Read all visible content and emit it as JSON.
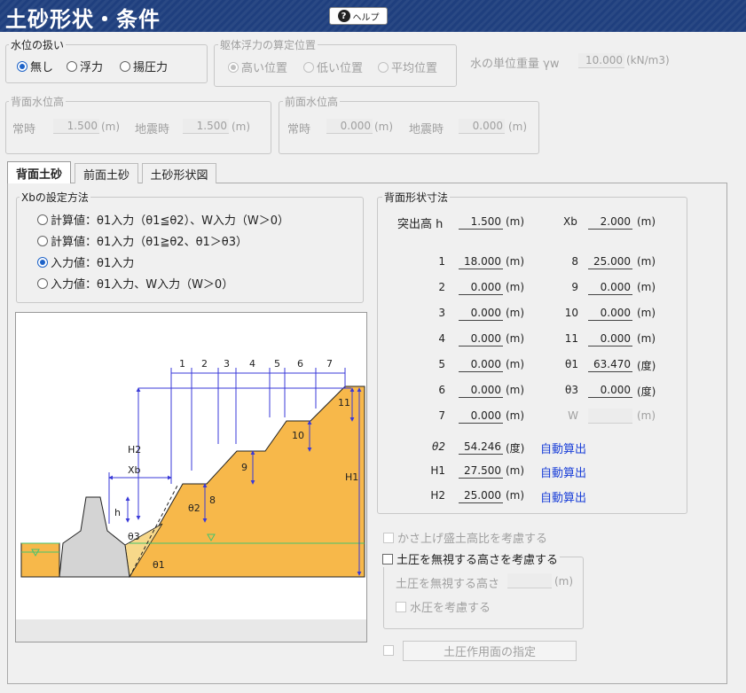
{
  "window": {
    "title": "土砂形状・条件",
    "help_label": "ヘルプ"
  },
  "water": {
    "label": "水位の扱い",
    "options": [
      "無し",
      "浮力",
      "揚圧力"
    ],
    "selected": "無し"
  },
  "buoyancy": {
    "label": "躯体浮力の算定位置",
    "options": [
      "高い位置",
      "低い位置",
      "平均位置"
    ],
    "selected": "高い位置"
  },
  "unit_weight": {
    "label": "水の単位重量 γw",
    "value": "10.000",
    "unit": "(kN/m3)"
  },
  "back_water": {
    "label": "背面水位高",
    "normal_label": "常時",
    "normal_value": "1.500",
    "normal_unit": "(m)",
    "quake_label": "地震時",
    "quake_value": "1.500",
    "quake_unit": "(m)"
  },
  "front_water": {
    "label": "前面水位高",
    "normal_label": "常時",
    "normal_value": "0.000",
    "normal_unit": "(m)",
    "quake_label": "地震時",
    "quake_value": "0.000",
    "quake_unit": "(m)"
  },
  "tabs": [
    {
      "label": "背面土砂",
      "active": true
    },
    {
      "label": "前面土砂",
      "active": false
    },
    {
      "label": "土砂形状図",
      "active": false
    }
  ],
  "xb_method": {
    "label": "Xbの設定方法",
    "options": [
      "計算値：θ1入力（θ1≦θ2）、W入力（W＞0）",
      "計算値：θ1入力（θ1≧θ2、θ1＞θ3）",
      "入力値：θ1入力",
      "入力値：θ1入力、W入力（W＞0）"
    ],
    "selected_index": 2
  },
  "shape": {
    "label": "背面形状寸法",
    "h_label": "突出高 h",
    "h_value": "1.500",
    "h_unit": "(m)",
    "xb_label": "Xb",
    "xb_value": "2.000",
    "xb_unit": "(m)",
    "left_rows": [
      {
        "label": "1",
        "value": "18.000",
        "unit": "(m)"
      },
      {
        "label": "2",
        "value": "0.000",
        "unit": "(m)"
      },
      {
        "label": "3",
        "value": "0.000",
        "unit": "(m)"
      },
      {
        "label": "4",
        "value": "0.000",
        "unit": "(m)"
      },
      {
        "label": "5",
        "value": "0.000",
        "unit": "(m)"
      },
      {
        "label": "6",
        "value": "0.000",
        "unit": "(m)"
      },
      {
        "label": "7",
        "value": "0.000",
        "unit": "(m)"
      }
    ],
    "right_rows": [
      {
        "label": "8",
        "value": "25.000",
        "unit": "(m)"
      },
      {
        "label": "9",
        "value": "0.000",
        "unit": "(m)"
      },
      {
        "label": "10",
        "value": "0.000",
        "unit": "(m)"
      },
      {
        "label": "11",
        "value": "0.000",
        "unit": "(m)"
      },
      {
        "label": "θ1",
        "value": "63.470",
        "unit": "(度)"
      },
      {
        "label": "θ3",
        "value": "0.000",
        "unit": "(度)"
      },
      {
        "label": "W",
        "value": "",
        "unit": "(m)"
      }
    ],
    "calc_rows": [
      {
        "label": "θ2",
        "value": "54.246",
        "unit": "(度)",
        "note": "自動算出"
      },
      {
        "label": "H1",
        "value": "27.500",
        "unit": "(m)",
        "note": "自動算出"
      },
      {
        "label": "H2",
        "value": "25.000",
        "unit": "(m)",
        "note": "自動算出"
      }
    ]
  },
  "options": {
    "fill_ratio_label": "かさ上げ盛土高比を考慮する",
    "ignore_height_label": "土圧を無視する高さを考慮する",
    "ignore_height_field_label": "土圧を無視する高さ",
    "ignore_height_unit": "(m)",
    "water_pressure_label": "水圧を考慮する",
    "pressure_face_label": "土圧作用面の指定"
  },
  "diagram": {
    "top_labels": [
      "1",
      "2",
      "3",
      "4",
      "5",
      "6",
      "7"
    ],
    "labels": {
      "h2": "H2",
      "h1": "H1",
      "xb": "Xb",
      "h": "h",
      "t1": "θ1",
      "t2": "θ2",
      "t3": "θ3",
      "d8": "8",
      "d9": "9",
      "d10": "10",
      "d11": "11"
    }
  }
}
